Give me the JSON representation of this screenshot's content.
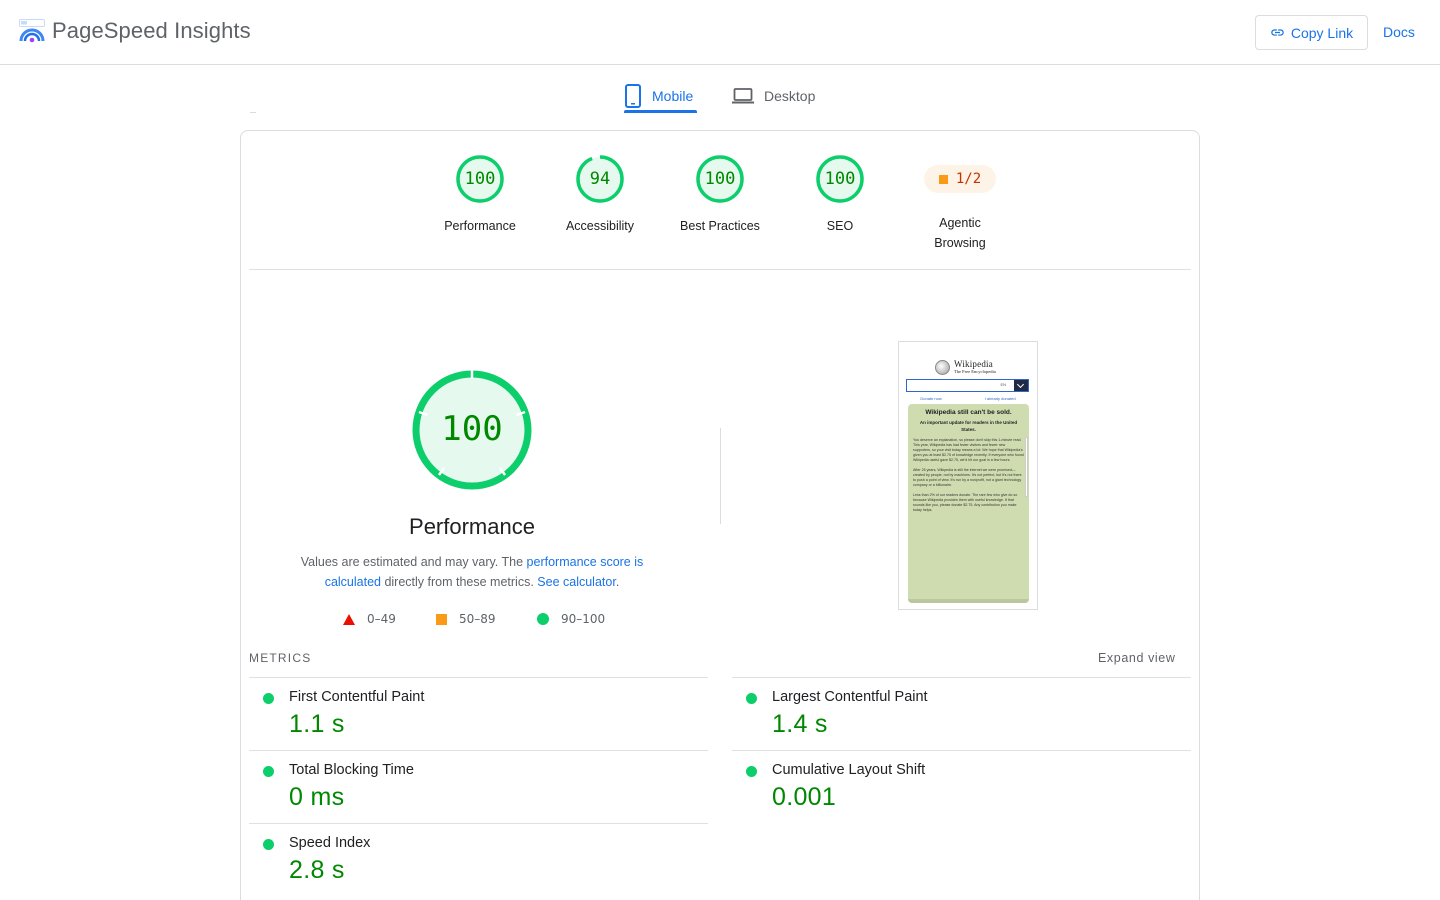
{
  "app": {
    "title": "PageSpeed Insights",
    "copy_link_label": "Copy Link",
    "docs_label": "Docs",
    "accent_color": "#1a73e8"
  },
  "tabs": [
    {
      "label": "Mobile",
      "icon": "phone-icon",
      "selected": true
    },
    {
      "label": "Desktop",
      "icon": "laptop-icon",
      "selected": false
    }
  ],
  "scores": [
    {
      "label": "Performance",
      "value": "100",
      "score": 100
    },
    {
      "label": "Accessibility",
      "value": "94",
      "score": 94
    },
    {
      "label": "Best Practices",
      "value": "100",
      "score": 100
    },
    {
      "label": "SEO",
      "value": "100",
      "score": 100
    }
  ],
  "agentic": {
    "value": "1/2",
    "label_line1": "Agentic",
    "label_line2": "Browsing"
  },
  "performance": {
    "score": "100",
    "score_fraction": 1.0,
    "title": "Performance",
    "desc_prefix": "Values are estimated and may vary. The ",
    "desc_link1": "performance score is calculated",
    "desc_mid": " directly from these metrics. ",
    "desc_link2": "See calculator",
    "desc_suffix": "."
  },
  "legend": {
    "fail": "0–49",
    "average": "50–89",
    "pass": "90–100",
    "fail_color": "#eb0f00",
    "average_color": "#fa9a19",
    "pass_color": "#0cce6b"
  },
  "screenshot": {
    "site_name": "Wikipedia",
    "tagline": "The Free Encyclopedia",
    "search_lang": "EN",
    "link_donate": "Donate now",
    "link_donated": "I already donated",
    "banner_heading": "Wikipedia still can't be sold.",
    "banner_sub": "An important update for readers in the United States.",
    "para1": "You deserve an explanation, so please don't skip this 1-minute read. This year, Wikipedia has had fewer visitors and fewer new supporters, so your visit today means a lot. We hope that Wikipedia's given you at least $2.75 of knowledge recently. If everyone who found Wikipedia useful gave $2.75, we'd hit our goal in a few hours.",
    "para2": "After 25 years, Wikipedia is still the internet we were promised—created by people, not by machines. It's not perfect, but it's not there to push a point of view. It's run by a nonprofit, not a giant technology company or a billionaire.",
    "para3": "Less than 2% of our readers donate. The rare few who give do so because Wikipedia provides them with useful knowledge. If that sounds like you, please donate $2.75. Any contribution you make today helps."
  },
  "metrics_section": {
    "label": "METRICS",
    "expand_label": "Expand view"
  },
  "metrics": [
    {
      "title": "First Contentful Paint",
      "value": "1.1 s"
    },
    {
      "title": "Largest Contentful Paint",
      "value": "1.4 s"
    },
    {
      "title": "Total Blocking Time",
      "value": "0 ms"
    },
    {
      "title": "Cumulative Layout Shift",
      "value": "0.001"
    },
    {
      "title": "Speed Index",
      "value": "2.8 s"
    }
  ]
}
